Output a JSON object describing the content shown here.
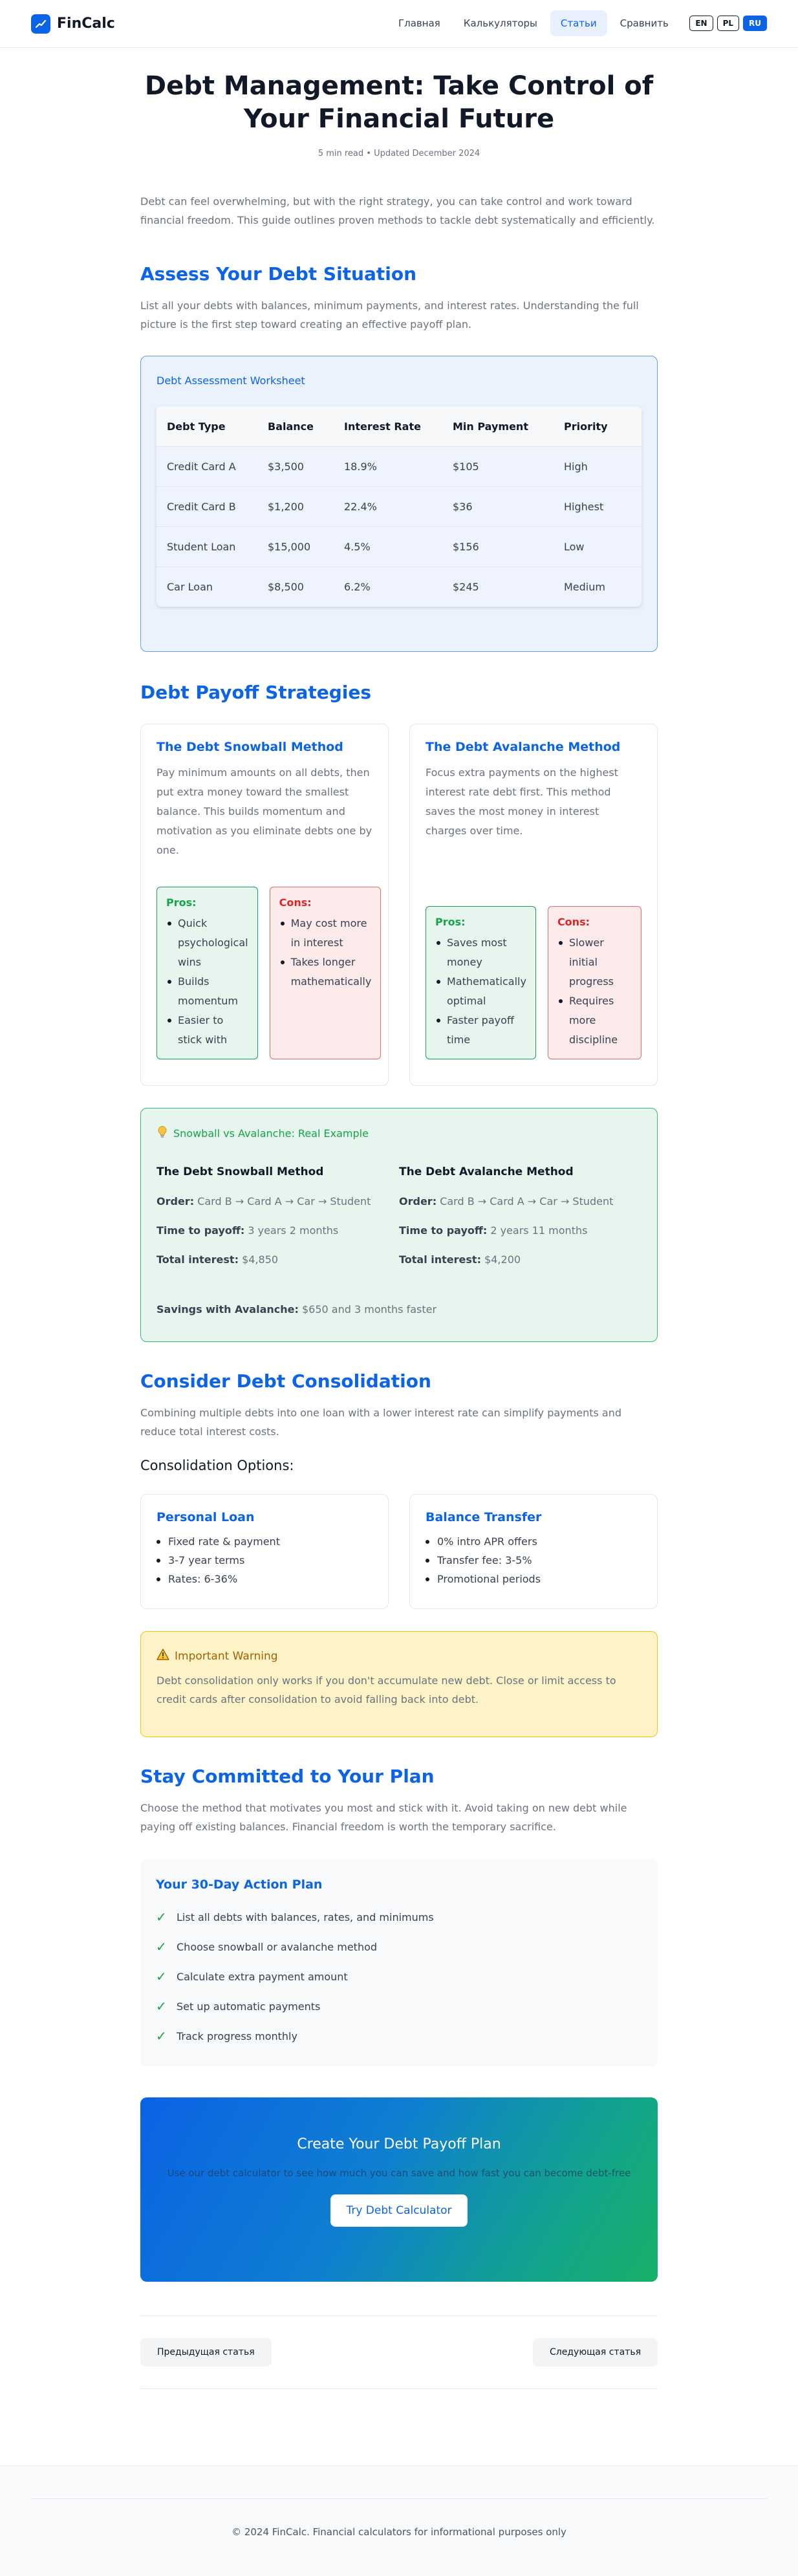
{
  "header": {
    "logo": "FinCalc",
    "nav": [
      "Главная",
      "Калькуляторы",
      "Статьи",
      "Сравнить"
    ],
    "active_nav": "Статьи",
    "langs": [
      "EN",
      "PL",
      "RU"
    ],
    "active_lang": "RU"
  },
  "article": {
    "title": "Debt Management: Take Control of Your Financial Future",
    "meta": "5 min read • Updated December 2024",
    "intro": "Debt can feel overwhelming, but with the right strategy, you can take control and work toward financial freedom. This guide outlines proven methods to tackle debt systematically and efficiently."
  },
  "assess": {
    "heading": "Assess Your Debt Situation",
    "text": "List all your debts with balances, minimum payments, and interest rates. Understanding the full picture is the first step toward creating an effective payoff plan.",
    "worksheet_title": "Debt Assessment Worksheet",
    "columns": [
      "Debt Type",
      "Balance",
      "Interest Rate",
      "Min Payment",
      "Priority"
    ],
    "rows": [
      [
        "Credit Card A",
        "$3,500",
        "18.9%",
        "$105",
        "High"
      ],
      [
        "Credit Card B",
        "$1,200",
        "22.4%",
        "$36",
        "Highest"
      ],
      [
        "Student Loan",
        "$15,000",
        "4.5%",
        "$156",
        "Low"
      ],
      [
        "Car Loan",
        "$8,500",
        "6.2%",
        "$245",
        "Medium"
      ]
    ]
  },
  "strategies": {
    "heading": "Debt Payoff Strategies",
    "snowball": {
      "title": "The Debt Snowball Method",
      "text": "Pay minimum amounts on all debts, then put extra money toward the smallest balance. This builds momentum and motivation as you eliminate debts one by one.",
      "pros_label": "Pros:",
      "pros": [
        "Quick psychological wins",
        "Builds momentum",
        "Easier to stick with"
      ],
      "cons_label": "Cons:",
      "cons": [
        "May cost more in interest",
        "Takes longer mathematically"
      ]
    },
    "avalanche": {
      "title": "The Debt Avalanche Method",
      "text": "Focus extra payments on the highest interest rate debt first. This method saves the most money in interest charges over time.",
      "pros_label": "Pros:",
      "pros": [
        "Saves most money",
        "Mathematically optimal",
        "Faster payoff time"
      ],
      "cons_label": "Cons:",
      "cons": [
        "Slower initial progress",
        "Requires more discipline"
      ]
    }
  },
  "example": {
    "title": "Snowball vs Avalanche: Real Example",
    "snowball": {
      "title": "The Debt Snowball Method",
      "order_label": "Order:",
      "order": "Card B → Card A → Car → Student",
      "time_label": "Time to payoff:",
      "time": "3 years 2 months",
      "interest_label": "Total interest:",
      "interest": "$4,850"
    },
    "avalanche": {
      "title": "The Debt Avalanche Method",
      "order_label": "Order:",
      "order": "Card B → Card A → Car → Student",
      "time_label": "Time to payoff:",
      "time": "2 years 11 months",
      "interest_label": "Total interest:",
      "interest": "$4,200"
    },
    "savings_label": "Savings with Avalanche:",
    "savings": "$650 and 3 months faster"
  },
  "consolidation": {
    "heading": "Consider Debt Consolidation",
    "text": "Combining multiple debts into one loan with a lower interest rate can simplify payments and reduce total interest costs.",
    "options_heading": "Consolidation Options:",
    "personal_loan": {
      "title": "Personal Loan",
      "items": [
        "Fixed rate & payment",
        "3-7 year terms",
        "Rates: 6-36%"
      ]
    },
    "balance_transfer": {
      "title": "Balance Transfer",
      "items": [
        "0% intro APR offers",
        "Transfer fee: 3-5%",
        "Promotional periods"
      ]
    },
    "warning_title": "Important Warning",
    "warning_text": "Debt consolidation only works if you don't accumulate new debt. Close or limit access to credit cards after consolidation to avoid falling back into debt."
  },
  "commit": {
    "heading": "Stay Committed to Your Plan",
    "text": "Choose the method that motivates you most and stick with it. Avoid taking on new debt while paying off existing balances. Financial freedom is worth the temporary sacrifice.",
    "plan_title": "Your 30-Day Action Plan",
    "items": [
      "List all debts with balances, rates, and minimums",
      "Choose snowball or avalanche method",
      "Calculate extra payment amount",
      "Set up automatic payments",
      "Track progress monthly"
    ]
  },
  "cta": {
    "title": "Create Your Debt Payoff Plan",
    "text": "Use our debt calculator to see how much you can save and how fast you can become debt-free",
    "button": "Try Debt Calculator"
  },
  "pager": {
    "prev": "Предыдущая статья",
    "next": "Следующая статья"
  },
  "footer": {
    "text": "© 2024 FinCalc. Financial calculators for informational purposes only"
  },
  "colors": {
    "accent": "#0b63e5",
    "success": "#16a34a",
    "danger": "#dc2626",
    "warning": "#a16207"
  }
}
